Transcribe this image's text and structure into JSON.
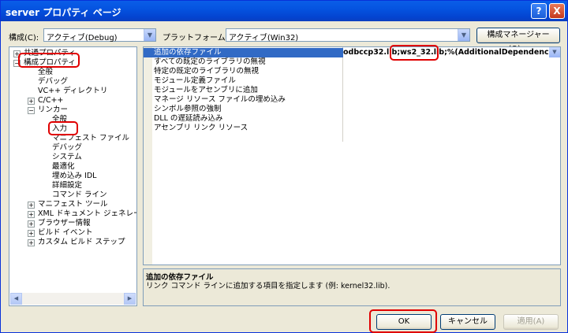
{
  "window": {
    "title": "server プロパティ ページ"
  },
  "title_buttons": {
    "help": "?",
    "close": "X"
  },
  "toolbar": {
    "config_label": "構成(C):",
    "config_value": "アクティブ(Debug)",
    "platform_label": "プラットフォーム(P):",
    "platform_value": "アクティブ(Win32)",
    "config_manager_label": "構成マネージャー(O)..."
  },
  "tree": {
    "common_props": "共通プロパティ",
    "config_props": "構成プロパティ",
    "general": "全般",
    "debugging": "デバッグ",
    "vc_dirs": "VC++ ディレクトリ",
    "cpp": "C/C++",
    "linker": "リンカー",
    "linker_children": [
      "全般",
      "入力",
      "マニフェスト ファイル",
      "デバッグ",
      "システム",
      "最適化",
      "埋め込み IDL",
      "詳細設定",
      "コマンド ライン"
    ],
    "after": [
      "マニフェスト ツール",
      "XML ドキュメント ジェネレーター",
      "ブラウザー情報",
      "ビルド イベント",
      "カスタム ビルド ステップ"
    ]
  },
  "grid": {
    "rows": [
      "追加の依存ファイル",
      "すべての既定のライブラリの無視",
      "特定の既定のライブラリの無視",
      "モジュール定義ファイル",
      "モジュールをアセンブリに追加",
      "マネージ リソース ファイルの埋め込み",
      "シンボル参照の強制",
      "DLL の遅延読み込み",
      "アセンブリ リンク リソース"
    ],
    "value_pre": "odbccp32.lib;",
    "value_hl": "ws2_32.lib",
    "value_post": ";%(AdditionalDependencies)"
  },
  "description": {
    "title": "追加の依存ファイル",
    "text": "リンク コマンド ラインに追加する項目を指定します (例: kernel32.lib)."
  },
  "buttons": {
    "ok": "OK",
    "cancel": "キャンセル",
    "apply": "適用(A)"
  }
}
